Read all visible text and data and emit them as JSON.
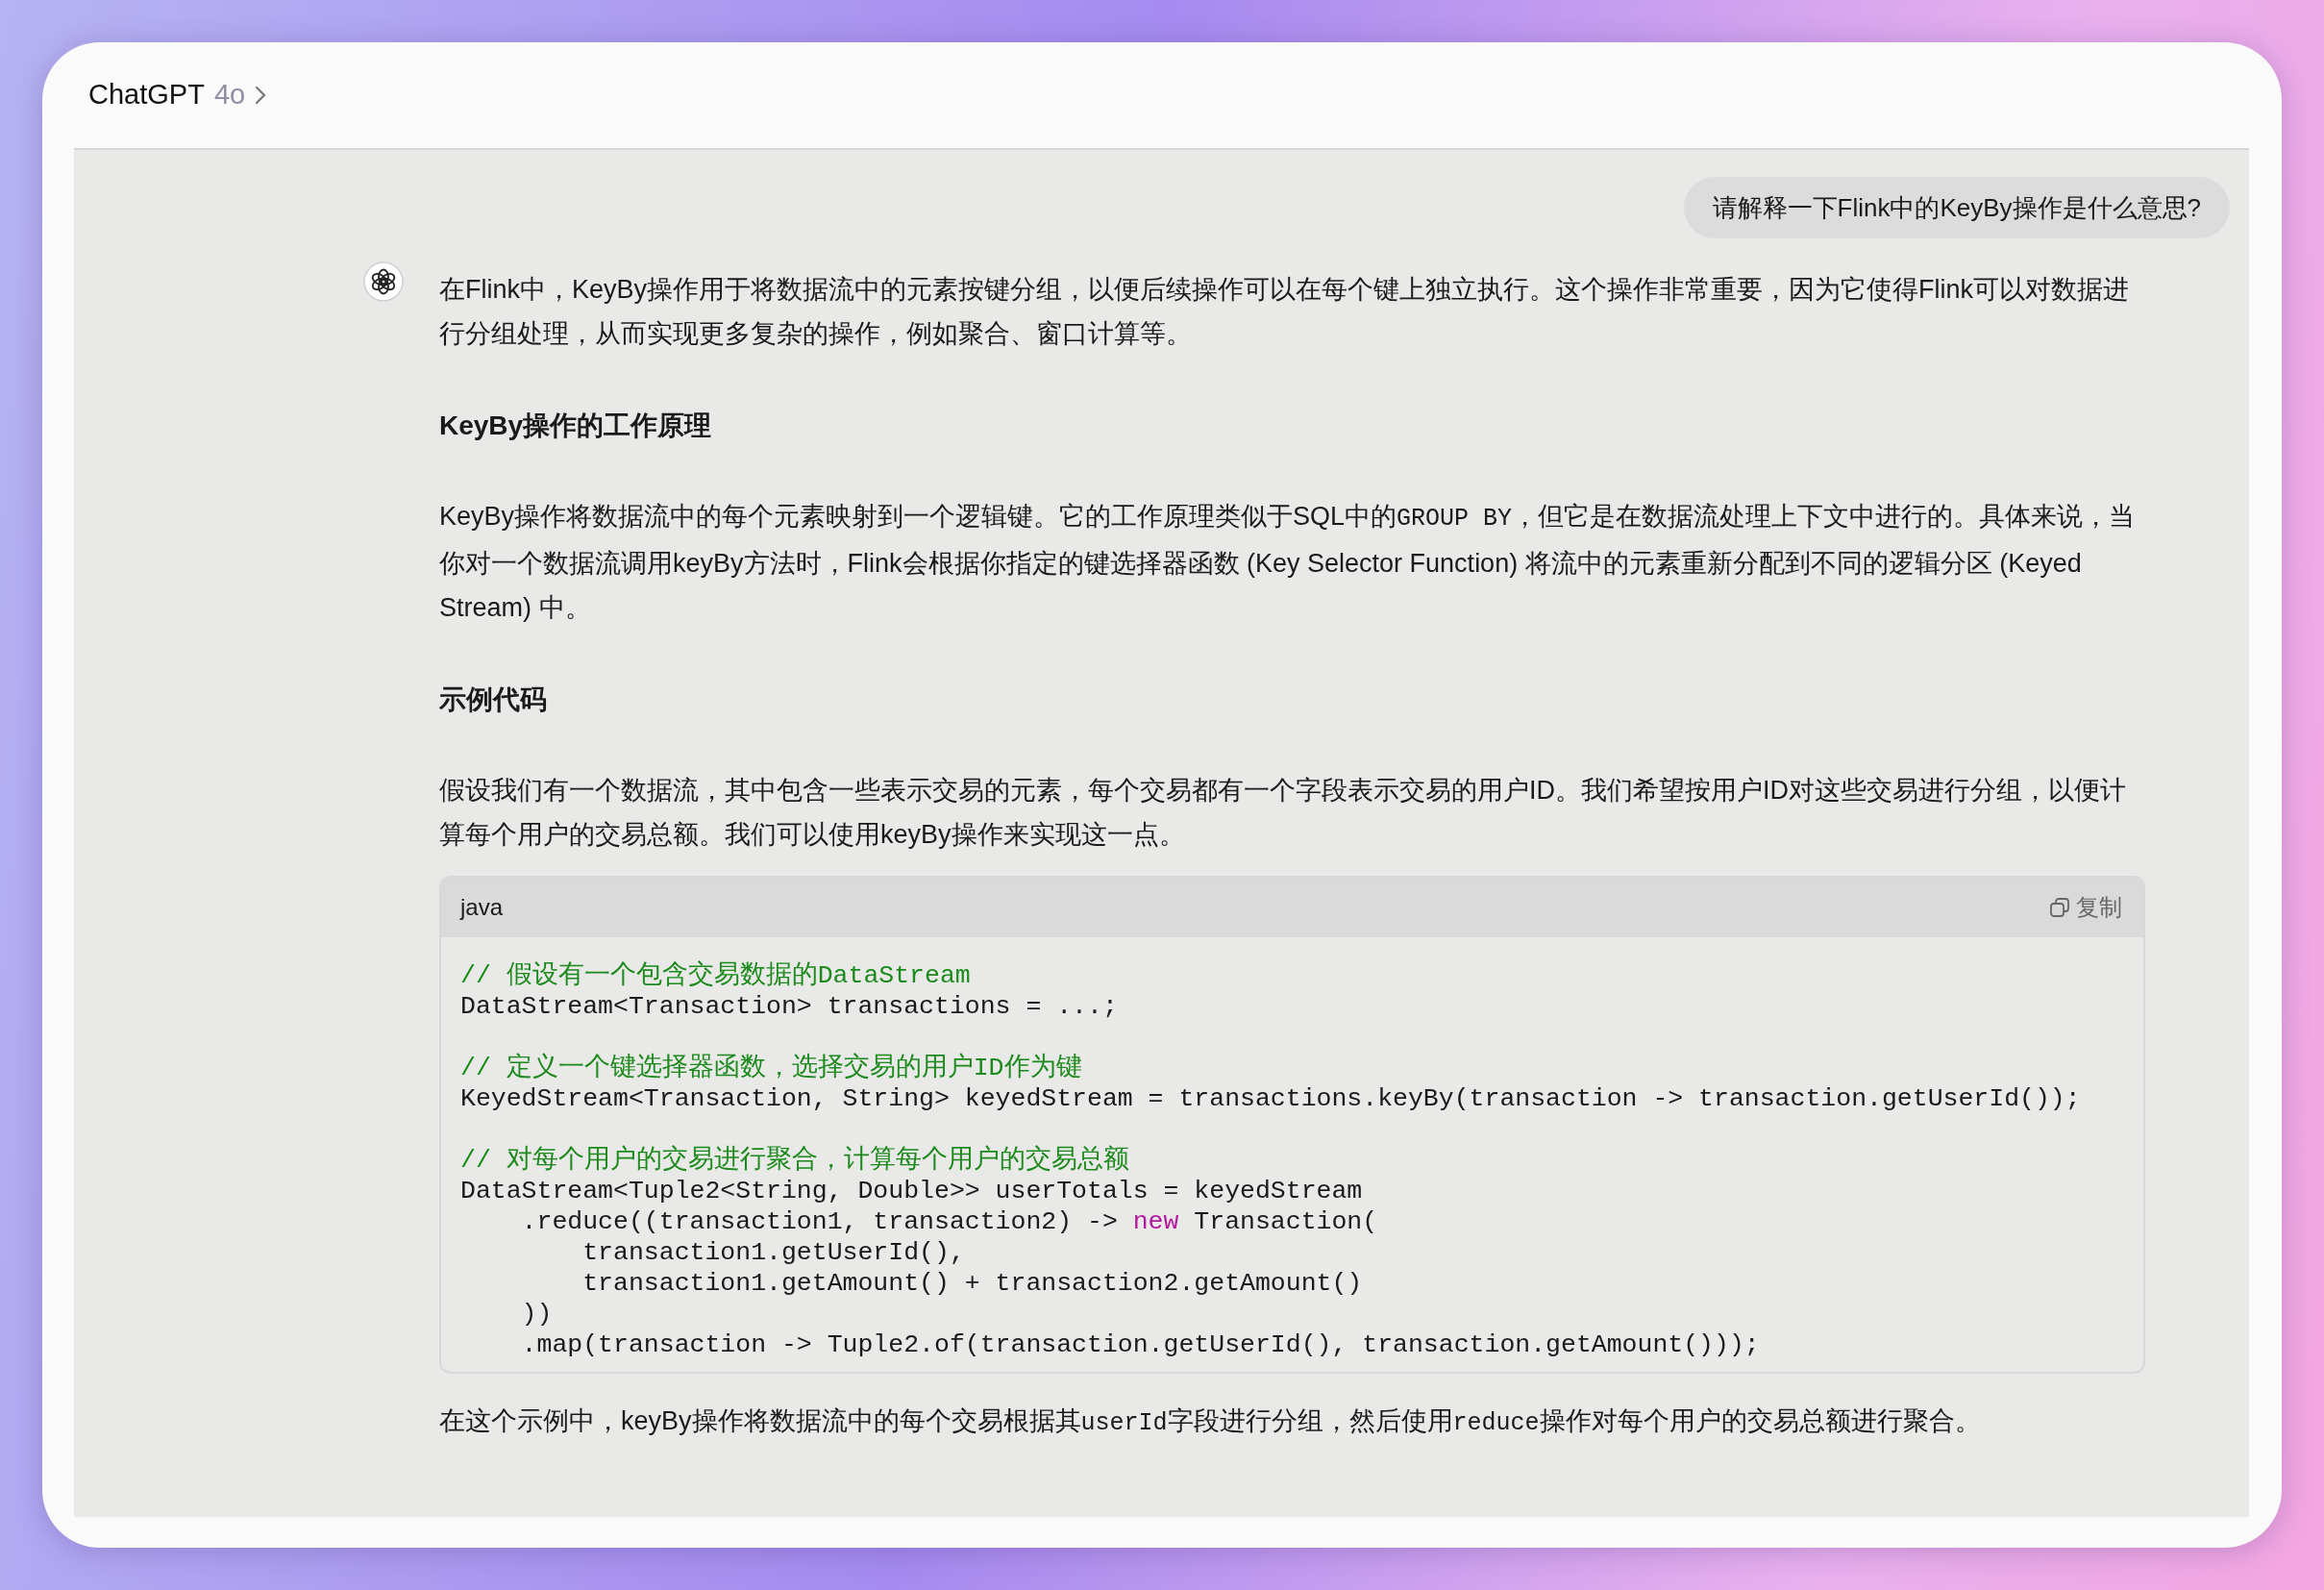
{
  "header": {
    "title": "ChatGPT",
    "model": "4o"
  },
  "user_message": {
    "text": "请解释一下Flink中的KeyBy操作是什么意思?"
  },
  "assistant_message": {
    "blocks": [
      {
        "kind": "paragraph",
        "segments": [
          {
            "kind": "text",
            "text": "在Flink中，KeyBy操作用于将数据流中的元素按键分组，以便后续操作可以在每个键上独立执行。这个操作非常重要，因为它使得Flink可以对数据进行分组处理，从而实现更多复杂的操作，例如聚合、窗口计算等。"
          }
        ]
      },
      {
        "kind": "heading",
        "text": "KeyBy操作的工作原理"
      },
      {
        "kind": "paragraph",
        "segments": [
          {
            "kind": "text",
            "text": "KeyBy操作将数据流中的每个元素映射到一个逻辑键。它的工作原理类似于SQL中的"
          },
          {
            "kind": "code",
            "text": "GROUP BY"
          },
          {
            "kind": "text",
            "text": "，但它是在数据流处理上下文中进行的。具体来说，当你对一个数据流调用keyBy方法时，Flink会根据你指定的键选择器函数 (Key Selector Function) 将流中的元素重新分配到不同的逻辑分区 (Keyed Stream) 中。"
          }
        ]
      },
      {
        "kind": "heading",
        "text": "示例代码"
      },
      {
        "kind": "paragraph",
        "segments": [
          {
            "kind": "text",
            "text": "假设我们有一个数据流，其中包含一些表示交易的元素，每个交易都有一个字段表示交易的用户ID。我们希望按用户ID对这些交易进行分组，以便计算每个用户的交易总额。我们可以使用keyBy操作来实现这一点。"
          }
        ]
      },
      {
        "kind": "code_block",
        "language": "java",
        "copy_label": "复制",
        "groups": [
          [
            [
              {
                "kind": "comment",
                "text": "// 假设有一个包含交易数据的DataStream"
              }
            ],
            [
              {
                "kind": "plain",
                "text": "DataStream<Transaction> transactions = ...;"
              }
            ]
          ],
          [
            [
              {
                "kind": "comment",
                "text": "// 定义一个键选择器函数，选择交易的用户ID作为键"
              }
            ],
            [
              {
                "kind": "plain",
                "text": "KeyedStream<Transaction, String> keyedStream = transactions.keyBy(transaction -> transaction.getUserId());"
              }
            ]
          ],
          [
            [
              {
                "kind": "comment",
                "text": "// 对每个用户的交易进行聚合，计算每个用户的交易总额"
              }
            ],
            [
              {
                "kind": "plain",
                "text": "DataStream<Tuple2<String, Double>> userTotals = keyedStream"
              }
            ],
            [
              {
                "kind": "plain",
                "text": "    .reduce((transaction1, transaction2) -> "
              },
              {
                "kind": "keyword",
                "text": "new"
              },
              {
                "kind": "plain",
                "text": " Transaction("
              }
            ],
            [
              {
                "kind": "plain",
                "text": "        transaction1.getUserId(),"
              }
            ],
            [
              {
                "kind": "plain",
                "text": "        transaction1.getAmount() + transaction2.getAmount()"
              }
            ],
            [
              {
                "kind": "plain",
                "text": "    ))"
              }
            ],
            [
              {
                "kind": "plain",
                "text": "    .map(transaction -> Tuple2.of(transaction.getUserId(), transaction.getAmount()));"
              }
            ]
          ]
        ]
      },
      {
        "kind": "paragraph",
        "segments": [
          {
            "kind": "text",
            "text": "在这个示例中，keyBy操作将数据流中的每个交易根据其"
          },
          {
            "kind": "code",
            "text": "userId"
          },
          {
            "kind": "text",
            "text": "字段进行分组，然后使用"
          },
          {
            "kind": "code",
            "text": "reduce"
          },
          {
            "kind": "text",
            "text": "操作对每个用户的交易总额进行聚合。"
          }
        ]
      }
    ]
  }
}
